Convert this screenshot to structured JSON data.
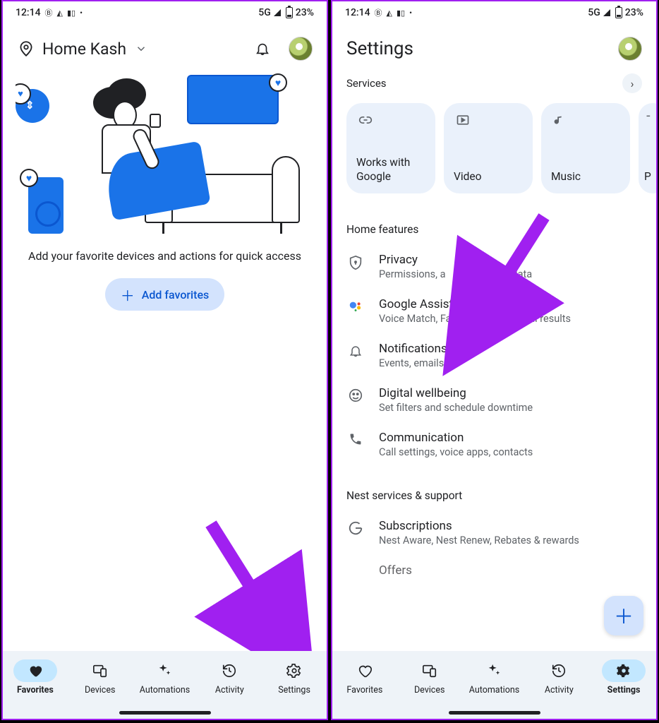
{
  "status": {
    "time": "12:14",
    "network": "5G",
    "battery_pct": "23%"
  },
  "left": {
    "home_name": "Home Kash",
    "hint": "Add your favorite devices and actions for quick access",
    "add_button": "Add favorites"
  },
  "nav": {
    "favorites": "Favorites",
    "devices": "Devices",
    "automations": "Automations",
    "activity": "Activity",
    "settings": "Settings"
  },
  "right": {
    "title": "Settings",
    "services_label": "Services",
    "cards": {
      "works": "Works with Google",
      "video": "Video",
      "music": "Music",
      "partial": "P"
    },
    "home_features": "Home features",
    "items": {
      "privacy": {
        "title": "Privacy",
        "sub_a": "Permissions, a",
        "sub_b": "t activity & data"
      },
      "assistant": {
        "title": "Google Assistant",
        "sub": "Voice Match, Face Match, personal results"
      },
      "notifications": {
        "title": "Notifications",
        "sub": "Events, emails"
      },
      "wellbeing": {
        "title": "Digital wellbeing",
        "sub": "Set filters and schedule downtime"
      },
      "communication": {
        "title": "Communication",
        "sub": "Call settings, voice apps, contacts"
      }
    },
    "nest_heading": "Nest services & support",
    "subscriptions": {
      "title": "Subscriptions",
      "sub": "Nest Aware, Nest Renew, Rebates & rewards"
    },
    "offers": {
      "title": "Offers"
    }
  }
}
